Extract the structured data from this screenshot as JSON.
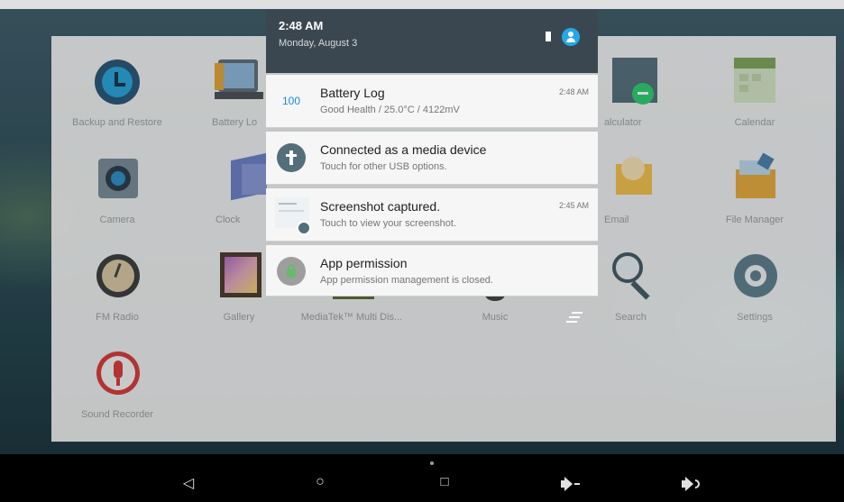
{
  "status": {
    "time": "2:48 AM",
    "date": "Monday, August 3"
  },
  "notifications": [
    {
      "icon": "battery-log-icon",
      "icon_text": "100",
      "title": "Battery Log",
      "text": "Good Health / 25.0°C / 4122mV",
      "time": "2:48 AM"
    },
    {
      "icon": "usb-icon",
      "title": "Connected as a media device",
      "text": "Touch for other USB options.",
      "time": ""
    },
    {
      "icon": "screenshot-icon",
      "title": "Screenshot captured.",
      "text": "Touch to view your screenshot.",
      "time": "2:45 AM"
    },
    {
      "icon": "lock-icon",
      "title": "App permission",
      "text": "App permission management is closed.",
      "time": ""
    }
  ],
  "apps": [
    {
      "label": "Backup and Restore",
      "icon": "backup-icon"
    },
    {
      "label": "Battery Lo",
      "icon": "battery-log-app-icon"
    },
    {
      "label": "alculator",
      "icon": "calculator-icon"
    },
    {
      "label": "Calendar",
      "icon": "calendar-icon"
    },
    {
      "label": "Camera",
      "icon": "camera-icon"
    },
    {
      "label": "Clock",
      "icon": "clock-icon"
    },
    {
      "label": "Email",
      "icon": "email-icon"
    },
    {
      "label": "File Manager",
      "icon": "file-manager-icon"
    },
    {
      "label": "FM Radio",
      "icon": "fm-radio-icon"
    },
    {
      "label": "Gallery",
      "icon": "gallery-icon"
    },
    {
      "label": "MediaTek™ Multi Dis...",
      "icon": "mediatek-icon"
    },
    {
      "label": "Music",
      "icon": "music-icon"
    },
    {
      "label": "Search",
      "icon": "search-icon"
    },
    {
      "label": "Settings",
      "icon": "settings-icon"
    },
    {
      "label": "Sound Recorder",
      "icon": "microphone-icon"
    }
  ],
  "nav": {
    "back": "◁",
    "home": "○",
    "recents": "□",
    "vol_down": "vol-down-icon",
    "vol_up": "vol-up-icon"
  },
  "colors": {
    "shade_header": "#3b4750",
    "accent": "#21a9e8",
    "notification_bg": "#f6f6f6"
  }
}
